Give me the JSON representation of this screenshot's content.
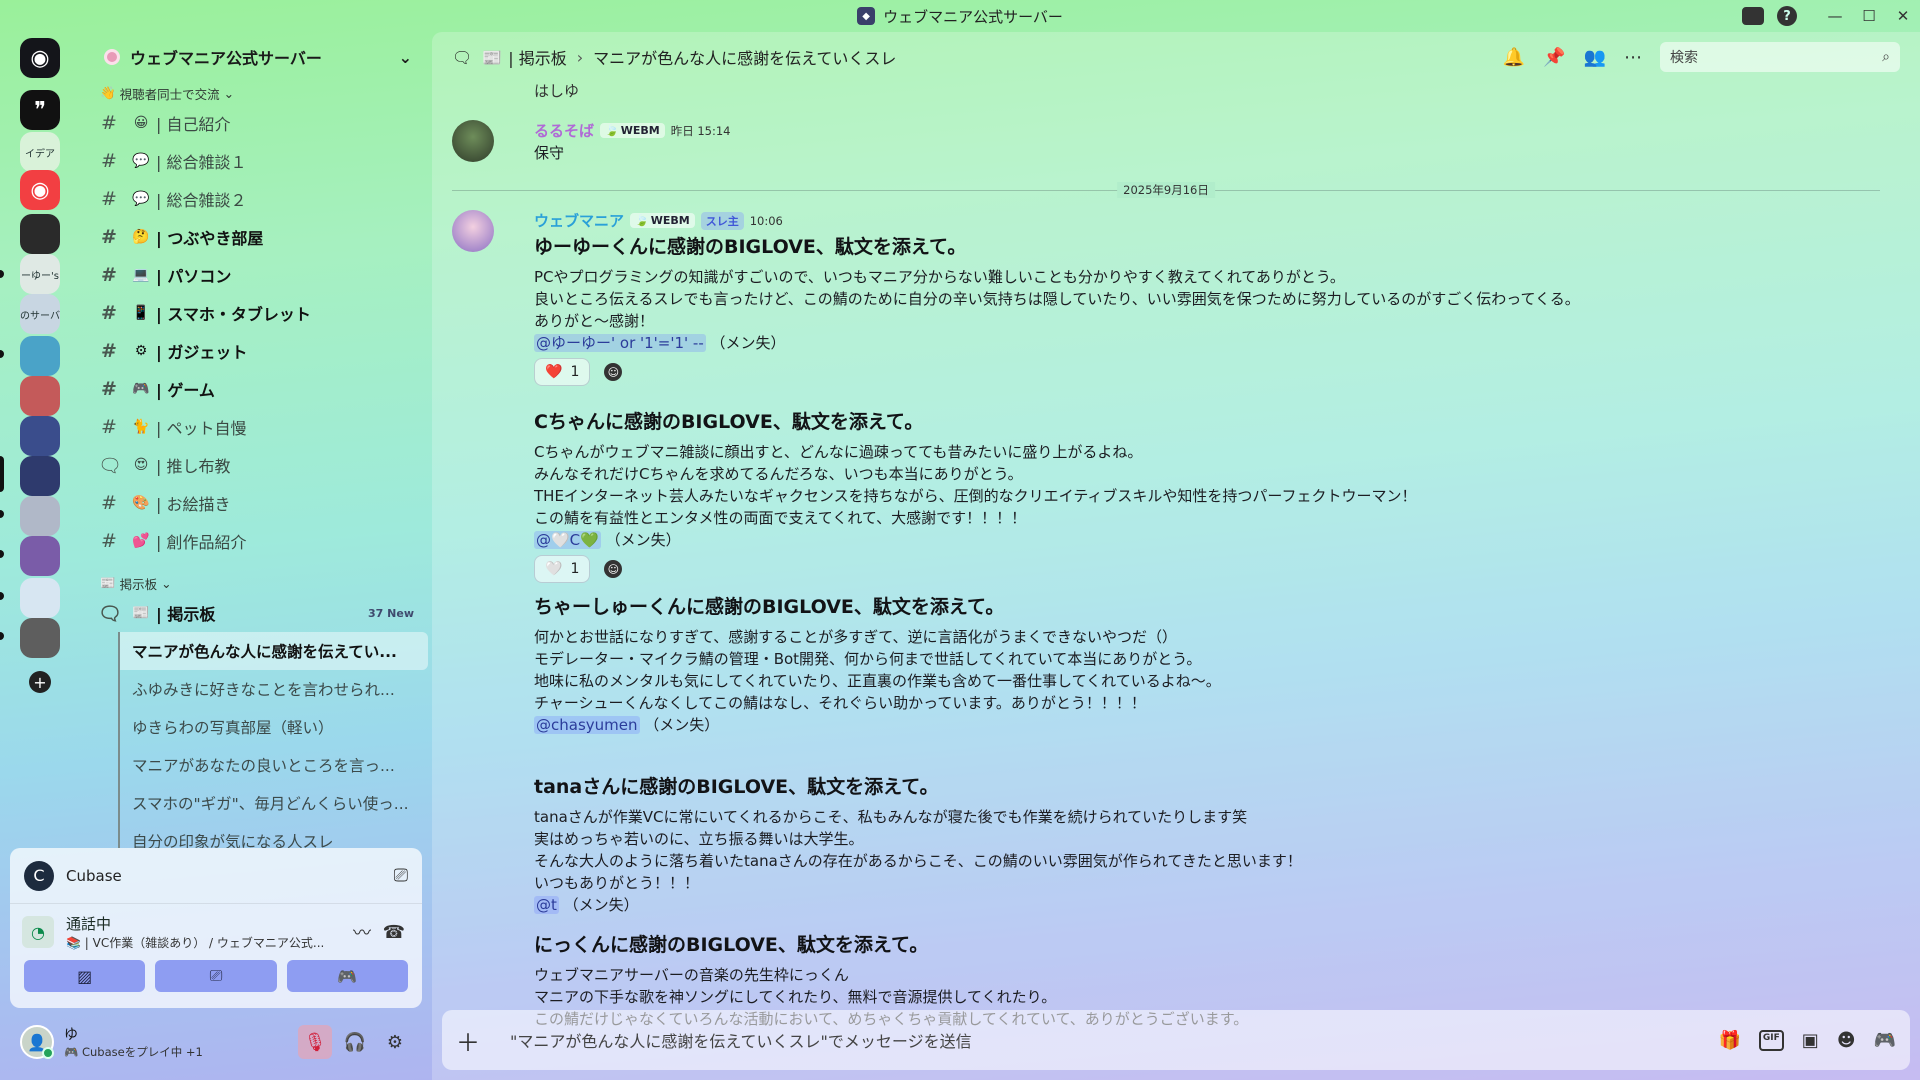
{
  "window": {
    "title": "ウェブマニア公式サーバー"
  },
  "servers": [
    {
      "label": "",
      "icon": "discord-home-icon",
      "bg": "#14151a"
    },
    {
      "label": "",
      "icon": "quote-icon",
      "bg": "#111"
    },
    {
      "label": "イデア",
      "icon": "",
      "bg": "#d9f2d9"
    },
    {
      "label": "",
      "icon": "discord-icon",
      "bg": "#f23f42"
    },
    {
      "label": "",
      "icon": "",
      "bg": "#2a2a2a"
    },
    {
      "label": "ーゆー's",
      "icon": "",
      "bg": "#dfe9e4"
    },
    {
      "label": "のサーバ",
      "icon": "",
      "bg": "#c8d6e2"
    },
    {
      "label": "",
      "icon": "",
      "bg": "#4aa3c8"
    },
    {
      "label": "",
      "icon": "",
      "bg": "#c45a5a"
    },
    {
      "label": "",
      "icon": "",
      "bg": "#3a4d8c"
    },
    {
      "label": "",
      "icon": "",
      "bg": "#2e3a6d"
    },
    {
      "label": "",
      "icon": "",
      "bg": "#b0b8c8"
    },
    {
      "label": "",
      "icon": "",
      "bg": "#7a5ca8"
    },
    {
      "label": "",
      "icon": "",
      "bg": "#d7e6f2"
    },
    {
      "label": "",
      "icon": "",
      "bg": "#5e5e5e"
    }
  ],
  "guild": {
    "name": "ウェブマニア公式サーバー"
  },
  "categories": {
    "c1": "視聴者同士で交流",
    "c2": "掲示板"
  },
  "channels": [
    {
      "emoji": "😀",
      "name": "| 自己紹介",
      "bold": false,
      "type": "text"
    },
    {
      "emoji": "💬",
      "name": "| 総合雑談１",
      "bold": false,
      "type": "text"
    },
    {
      "emoji": "💬",
      "name": "| 総合雑談２",
      "bold": false,
      "type": "text"
    },
    {
      "emoji": "🤔",
      "name": "| つぶやき部屋",
      "bold": true,
      "type": "text"
    },
    {
      "emoji": "💻",
      "name": "| パソコン",
      "bold": true,
      "type": "text"
    },
    {
      "emoji": "📱",
      "name": "| スマホ・タブレット",
      "bold": true,
      "type": "text"
    },
    {
      "emoji": "⚙",
      "name": "| ガジェット",
      "bold": true,
      "type": "text"
    },
    {
      "emoji": "🎮",
      "name": "| ゲーム",
      "bold": true,
      "type": "text"
    },
    {
      "emoji": "🐈",
      "name": "| ペット自慢",
      "bold": false,
      "type": "text"
    },
    {
      "emoji": "😍",
      "name": "| 推し布教",
      "bold": false,
      "type": "forum"
    },
    {
      "emoji": "🎨",
      "name": "| お絵描き",
      "bold": false,
      "type": "text"
    },
    {
      "emoji": "💕",
      "name": "| 創作品紹介",
      "bold": false,
      "type": "text"
    }
  ],
  "forum": {
    "emoji": "📰",
    "name": "| 掲示板",
    "badge": "37 New"
  },
  "threads": [
    "マニアが色んな人に感謝を伝えてい...",
    "ふゆみきに好きなことを言わせられ...",
    "ゆきらわの写真部屋（軽い）",
    "マニアがあなたの良いところを言っ...",
    "スマホの\"ギガ\"、毎月どんくらい使っ...",
    "自分の印象が気になる人スレ"
  ],
  "activity": {
    "name": "Cubase"
  },
  "voice": {
    "status": "通話中",
    "channel": "📚 | VC作業（雑談あり） / ウェブマニア公式..."
  },
  "user": {
    "name": "ゆ",
    "status": "🎮 Cubaseをプレイ中 +1"
  },
  "topbar": {
    "parent": "| 掲示板",
    "thread": "マニアが色んな人に感謝を伝えていくスレ",
    "search_placeholder": "検索"
  },
  "messages": {
    "top_fragment": "はしゆ",
    "rurusoba": {
      "name": "るるそば",
      "tag": "WEBM",
      "time": "昨日 15:14",
      "text": "保守",
      "color": "#b06ad6"
    },
    "date_divider": "2025年9月16日",
    "mania": {
      "name": "ウェブマニア",
      "tag": "WEBM",
      "op": "スレ主",
      "time": "10:06",
      "color": "#2aa0d8"
    },
    "blocks": [
      {
        "title": "ゆーゆーくんに感謝のBIGLOVE、駄文を添えて。",
        "lines": [
          "PCやプログラミングの知識がすごいので、いつもマニア分からない難しいことも分かりやすく教えてくれてありがとう。",
          "良いところ伝えるスレでも言ったけど、この鯖のために自分の辛い気持ちは隠していたり、いい雰囲気を保つために努力しているのがすごく伝わってくる。",
          "ありがと〜感謝！"
        ],
        "mention": "@ゆーゆー' or '1'='1' --",
        "suffix": "（メン失）",
        "reaction": {
          "emoji": "❤️",
          "count": "1"
        }
      },
      {
        "title": "Cちゃんに感謝のBIGLOVE、駄文を添えて。",
        "lines": [
          "Cちゃんがウェブマニ雑談に顔出すと、どんなに過疎ってても昔みたいに盛り上がるよね。",
          "みんなそれだけCちゃんを求めてるんだろな、いつも本当にありがとう。",
          "THEインターネット芸人みたいなギャクセンスを持ちながら、圧倒的なクリエイティブスキルや知性を持つパーフェクトウーマン！",
          "この鯖を有益性とエンタメ性の両面で支えてくれて、大感謝です！！！！"
        ],
        "mention": "@🤍C💚",
        "suffix": "（メン失）",
        "reaction": {
          "emoji": "🤍",
          "count": "1"
        }
      },
      {
        "title": "ちゃーしゅーくんに感謝のBIGLOVE、駄文を添えて。",
        "lines": [
          "何かとお世話になりすぎて、感謝することが多すぎて、逆に言語化がうまくできないやつだ（）",
          "モデレーター・マイクラ鯖の管理・Bot開発、何から何まで世話してくれていて本当にありがとう。",
          "地味に私のメンタルも気にしてくれていたり、正直裏の作業も含めて一番仕事してくれているよね〜。",
          "チャーシューくんなくしてこの鯖はなし、それぐらい助かっています。ありがとう！！！！"
        ],
        "mention": "@chasyumen",
        "suffix": "（メン失）"
      },
      {
        "title": "tanaさんに感謝のBIGLOVE、駄文を添えて。",
        "lines": [
          "tanaさんが作業VCに常にいてくれるからこそ、私もみんなが寝た後でも作業を続けられていたりします笑",
          "実はめっちゃ若いのに、立ち振る舞いは大学生。",
          "そんな大人のように落ち着いたtanaさんの存在があるからこそ、この鯖のいい雰囲気が作られてきたと思います！",
          "いつもありがとう！！！"
        ],
        "mention": "@t",
        "suffix": "（メン失）"
      },
      {
        "title": "にっくんに感謝のBIGLOVE、駄文を添えて。",
        "lines": [
          "ウェブマニアサーバーの音楽の先生枠にっくん",
          "マニアの下手な歌を神ソングにしてくれたり、無料で音源提供してくれたり。",
          "この鯖だけじゃなくていろんな活動において、めちゃくちゃ貢献してくれていて、ありがとうございます。"
        ]
      }
    ]
  },
  "composer": {
    "placeholder": "\"マニアが色んな人に感謝を伝えていくスレ\"でメッセージを送信"
  }
}
